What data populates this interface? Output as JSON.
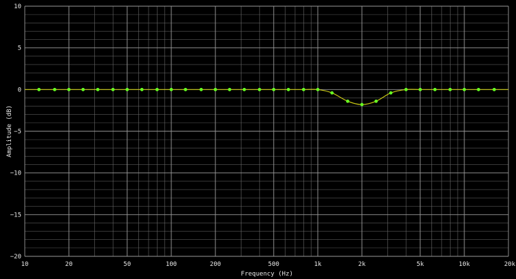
{
  "chart_data": {
    "type": "line",
    "title": "",
    "xlabel": "Frequency (Hz)",
    "ylabel": "Amplitude (dB)",
    "xscale": "log",
    "xlim": [
      10,
      20000
    ],
    "ylim": [
      -20,
      10
    ],
    "grid": true,
    "legend": "none",
    "x_ticks": [
      {
        "value": 10,
        "label": "10"
      },
      {
        "value": 20,
        "label": "20"
      },
      {
        "value": 50,
        "label": "50"
      },
      {
        "value": 100,
        "label": "100"
      },
      {
        "value": 200,
        "label": "200"
      },
      {
        "value": 500,
        "label": "500"
      },
      {
        "value": 1000,
        "label": "1k"
      },
      {
        "value": 2000,
        "label": "2k"
      },
      {
        "value": 5000,
        "label": "5k"
      },
      {
        "value": 10000,
        "label": "10k"
      },
      {
        "value": 20000,
        "label": "20k"
      }
    ],
    "y_ticks": [
      {
        "value": 10,
        "label": "10"
      },
      {
        "value": 5,
        "label": "5"
      },
      {
        "value": 0,
        "label": "0"
      },
      {
        "value": -5,
        "label": "−5"
      },
      {
        "value": -10,
        "label": "−10"
      },
      {
        "value": -15,
        "label": "−15"
      },
      {
        "value": -20,
        "label": "−20"
      }
    ],
    "series": [
      {
        "color": "#c8c814",
        "marker_color": "#66ff22",
        "x": [
          12.5,
          16,
          20,
          25,
          31.5,
          40,
          50,
          63,
          80,
          100,
          125,
          160,
          200,
          250,
          315,
          400,
          500,
          630,
          800,
          1000,
          1250,
          1600,
          2000,
          2500,
          3150,
          4000,
          5000,
          6300,
          8000,
          10000,
          12500,
          16000
        ],
        "y": [
          0,
          0,
          0,
          0,
          0,
          0,
          0,
          0,
          0,
          0,
          0,
          0,
          0,
          0,
          0,
          0,
          0,
          0,
          0,
          0,
          -0.4,
          -1.4,
          -1.8,
          -1.4,
          -0.4,
          0,
          0,
          0,
          0,
          0,
          0,
          0
        ]
      }
    ]
  }
}
